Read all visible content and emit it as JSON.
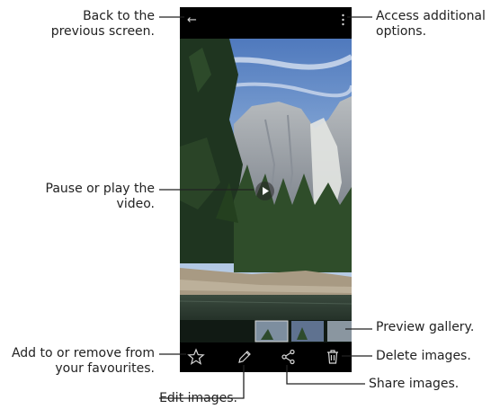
{
  "callouts": {
    "back": [
      "Back to the",
      "previous screen."
    ],
    "options": [
      "Access additional",
      "options."
    ],
    "play": [
      "Pause or play the",
      "video."
    ],
    "preview": "Preview gallery.",
    "favourite": [
      "Add to or remove from",
      "your favourites."
    ],
    "delete": "Delete images.",
    "share": "Share images.",
    "edit": "Edit images."
  },
  "icons": {
    "back": "back-arrow-icon",
    "more": "more-options-icon",
    "play": "play-icon",
    "favourite": "star-icon",
    "edit": "pencil-icon",
    "share": "share-icon",
    "delete": "trash-icon"
  },
  "colors": {
    "leader_line": "#222222",
    "phone_frame": "#000000",
    "icon": "#d8d8d8"
  }
}
